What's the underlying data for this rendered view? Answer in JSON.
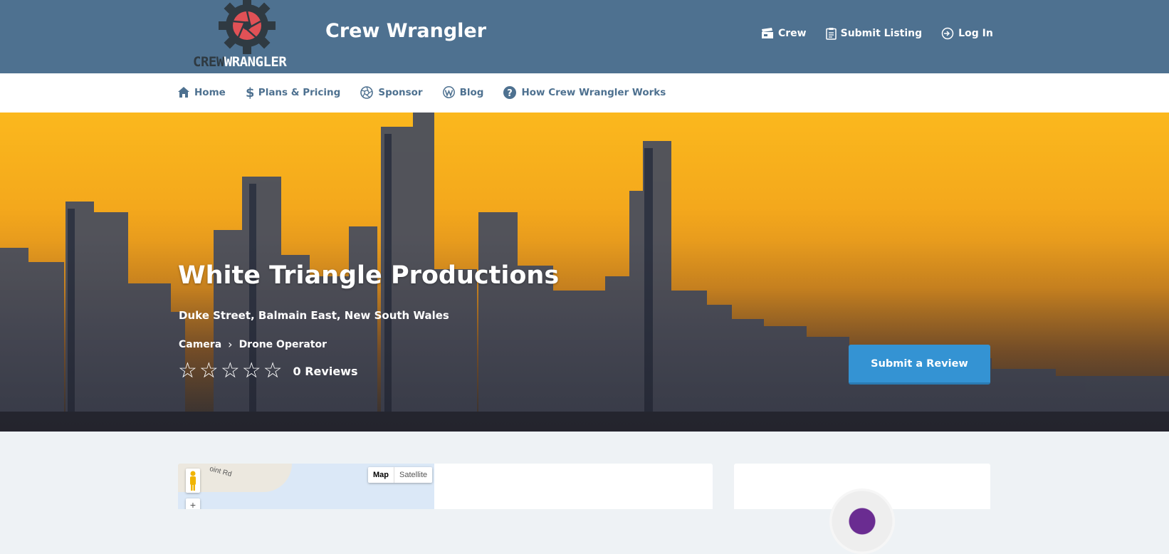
{
  "header": {
    "logo_word_1": "CREW",
    "logo_word_2": "WRANGLER",
    "site_title": "Crew Wrangler",
    "links": [
      {
        "label": "Crew",
        "icon": "clapperboard-icon"
      },
      {
        "label": "Submit Listing",
        "icon": "clipboard-icon"
      },
      {
        "label": "Log In",
        "icon": "login-icon"
      }
    ]
  },
  "nav": {
    "items": [
      {
        "label": "Home",
        "icon": "home-icon"
      },
      {
        "label": "Plans & Pricing",
        "icon": "dollar-icon"
      },
      {
        "label": "Sponsor",
        "icon": "aperture-icon"
      },
      {
        "label": "Blog",
        "icon": "wordpress-icon"
      },
      {
        "label": "How Crew Wrangler Works",
        "icon": "question-icon"
      }
    ]
  },
  "listing": {
    "title": "White Triangle Productions",
    "address": "Duke Street, Balmain East, New South Wales",
    "category": "Camera",
    "subcategory": "Drone Operator",
    "rating_stars": 0,
    "rating_max": 5,
    "reviews_label": "0 Reviews",
    "review_button": "Submit a Review"
  },
  "map": {
    "type_map": "Map",
    "type_satellite": "Satellite",
    "road_label": "oint Rd",
    "zoom_in": "+"
  },
  "colors": {
    "header_bg": "#4e7190",
    "accent_button": "#3493d3",
    "page_bg": "#eef2f5"
  }
}
